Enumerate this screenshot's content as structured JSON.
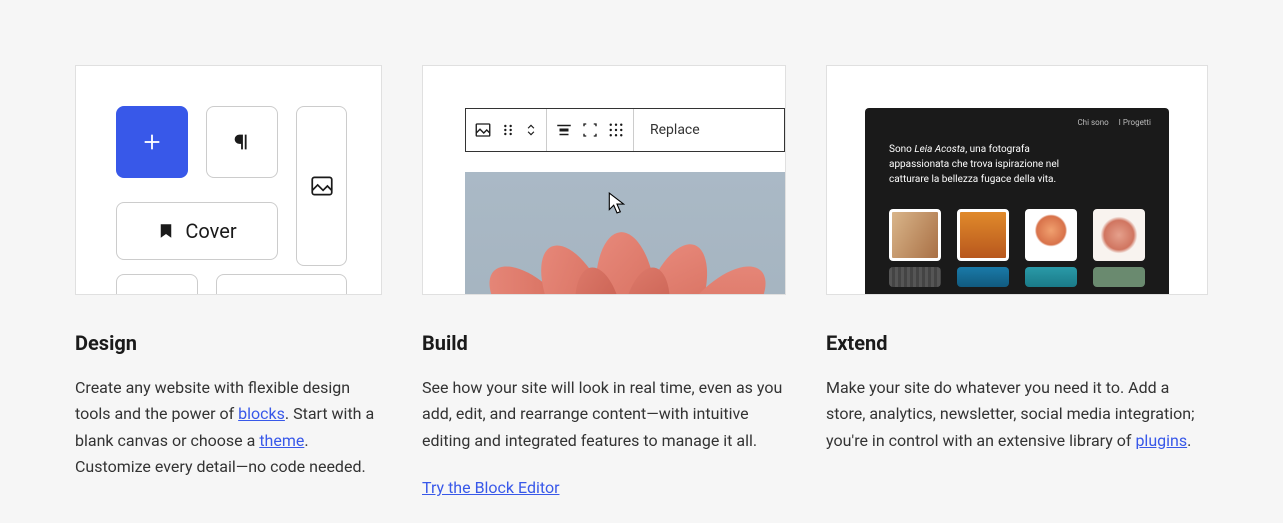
{
  "cards": [
    {
      "title": "Design",
      "description_parts": {
        "p1": "Create any website with flexible design tools and the power of ",
        "link1": "blocks",
        "p2": ". Start with a blank canvas or choose a ",
        "link2": "theme",
        "p3": ". Customize every detail—no code needed."
      },
      "preview": {
        "cover_label": "Cover"
      }
    },
    {
      "title": "Build",
      "description": "See how your site will look in real time, even as you add, edit, and rearrange content—with intuitive editing and integrated features to manage it all.",
      "link": "Try the Block Editor",
      "preview": {
        "replace_label": "Replace"
      }
    },
    {
      "title": "Extend",
      "description_parts": {
        "p1": "Make your site do whatever you need it to. Add a store, analytics, newsletter, social media integration; you're in control with an extensive library of ",
        "link1": "plugins",
        "p2": "."
      },
      "preview": {
        "nav1": "Chi sono",
        "nav2": "I Progetti",
        "intro_pre": "Sono ",
        "intro_name": "Leia Acosta",
        "intro_post": ", una fotografa appassionata che trova ispirazione nel catturare la bellezza fugace della vita."
      }
    }
  ]
}
